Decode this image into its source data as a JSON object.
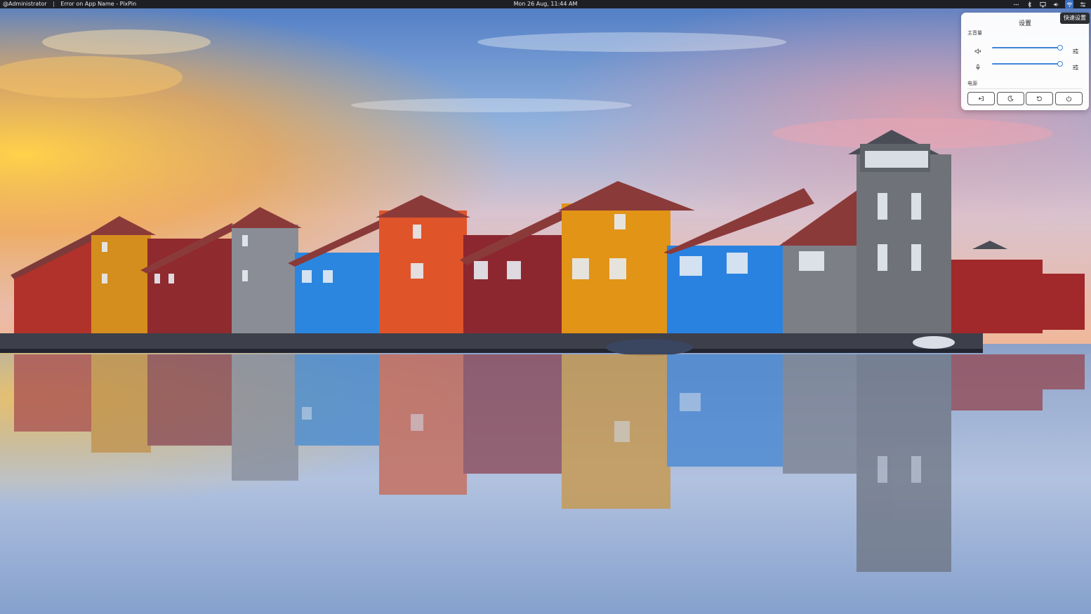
{
  "topbar": {
    "user": "@Administrator",
    "separator": "|",
    "window_title": "Error on App Name - PixPin",
    "clock": "Mon 26 Aug, 11:44 AM"
  },
  "tray": {
    "icons": [
      "more-icon",
      "bluetooth-icon",
      "display-icon",
      "volume-icon",
      "network-icon",
      "quick-settings-icon"
    ]
  },
  "tooltip": {
    "text": "快速设置"
  },
  "quick_settings": {
    "title": "设置",
    "volume_section_label": "主音量",
    "output": {
      "icon": "speaker-icon",
      "level": 1.0
    },
    "input": {
      "icon": "microphone-icon",
      "level": 1.0
    },
    "power_section_label": "电源",
    "power_buttons": [
      "logout-icon",
      "sleep-icon",
      "restart-icon",
      "power-icon"
    ]
  },
  "colors": {
    "topbar": "#1d1f24",
    "accent": "#3f86d8",
    "panel": "#ffffff"
  },
  "wallpaper": {
    "subject": "colorful-waterfront-houses"
  }
}
